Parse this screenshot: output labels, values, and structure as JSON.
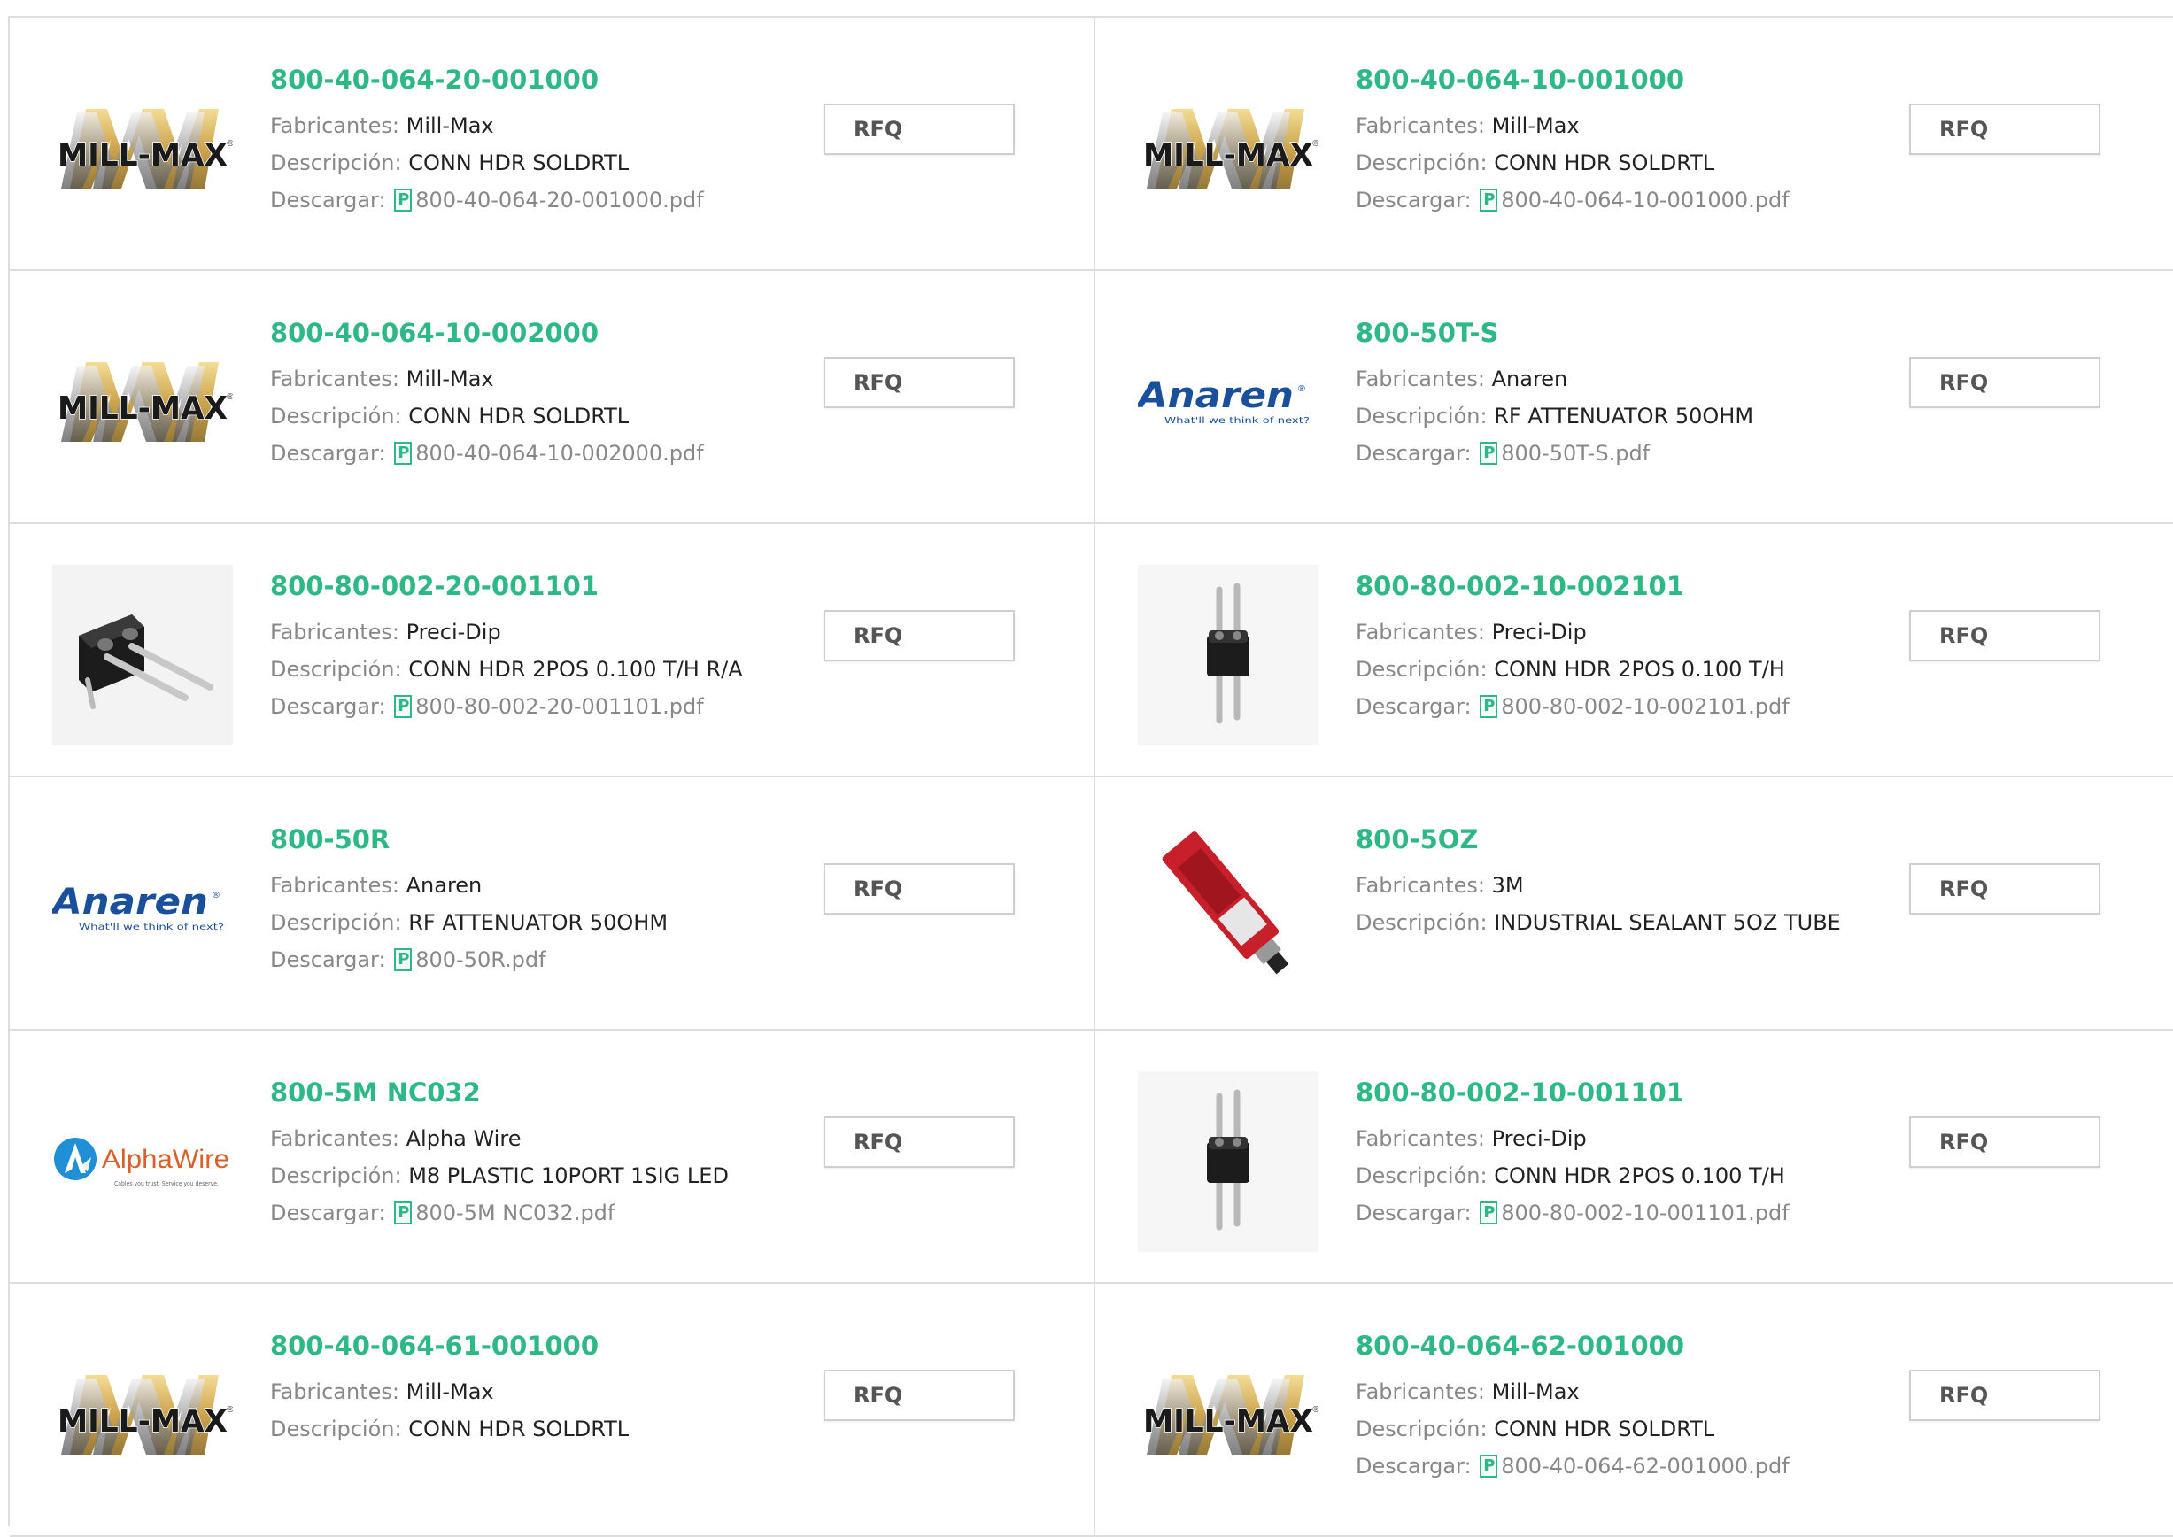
{
  "labels": {
    "manufacturer": "Fabricantes:",
    "description": "Descripción:",
    "download": "Descargar:",
    "rfq": "RFQ"
  },
  "colors": {
    "accent": "#2eb886",
    "border": "#dddddd"
  },
  "products": [
    {
      "part": "800-40-064-20-001000",
      "manufacturer": "Mill-Max",
      "description": "CONN HDR SOLDRTL",
      "pdf": "800-40-064-20-001000.pdf",
      "logo": "mill-max-logo"
    },
    {
      "part": "800-40-064-10-001000",
      "manufacturer": "Mill-Max",
      "description": "CONN HDR SOLDRTL",
      "pdf": "800-40-064-10-001000.pdf",
      "logo": "mill-max-logo"
    },
    {
      "part": "800-40-064-10-002000",
      "manufacturer": "Mill-Max",
      "description": "CONN HDR SOLDRTL",
      "pdf": "800-40-064-10-002000.pdf",
      "logo": "mill-max-logo"
    },
    {
      "part": "800-50T-S",
      "manufacturer": "Anaren",
      "description": "RF ATTENUATOR 50OHM",
      "pdf": "800-50T-S.pdf",
      "logo": "anaren-logo"
    },
    {
      "part": "800-80-002-20-001101",
      "manufacturer": "Preci-Dip",
      "description": "CONN HDR 2POS 0.100 T/H R/A",
      "pdf": "800-80-002-20-001101.pdf",
      "logo": "right-angle-header-photo"
    },
    {
      "part": "800-80-002-10-002101",
      "manufacturer": "Preci-Dip",
      "description": "CONN HDR 2POS 0.100 T/H",
      "pdf": "800-80-002-10-002101.pdf",
      "logo": "straight-header-photo"
    },
    {
      "part": "800-50R",
      "manufacturer": "Anaren",
      "description": "RF ATTENUATOR 50OHM",
      "pdf": "800-50R.pdf",
      "logo": "anaren-logo"
    },
    {
      "part": "800-5OZ",
      "manufacturer": "3M",
      "description": "INDUSTRIAL SEALANT 5OZ TUBE",
      "pdf": null,
      "logo": "sealant-tube-photo"
    },
    {
      "part": "800-5M NC032",
      "manufacturer": "Alpha Wire",
      "description": "M8 PLASTIC 10PORT 1SIG LED",
      "pdf": "800-5M NC032.pdf",
      "logo": "alpha-wire-logo"
    },
    {
      "part": "800-80-002-10-001101",
      "manufacturer": "Preci-Dip",
      "description": "CONN HDR 2POS 0.100 T/H",
      "pdf": "800-80-002-10-001101.pdf",
      "logo": "straight-header-photo"
    },
    {
      "part": "800-40-064-61-001000",
      "manufacturer": "Mill-Max",
      "description": "CONN HDR SOLDRTL",
      "pdf": null,
      "logo": "mill-max-logo"
    },
    {
      "part": "800-40-064-62-001000",
      "manufacturer": "Mill-Max",
      "description": "CONN HDR SOLDRTL",
      "pdf": "800-40-064-62-001000.pdf",
      "logo": "mill-max-logo"
    }
  ],
  "logo_text": {
    "mill_max": "MILL-MAX",
    "anaren": "Anaren",
    "anaren_tagline": "What'll we think of next?",
    "alpha_wire": "AlphaWire",
    "alpha_wire_tagline": "Cables you trust. Service you deserve."
  }
}
